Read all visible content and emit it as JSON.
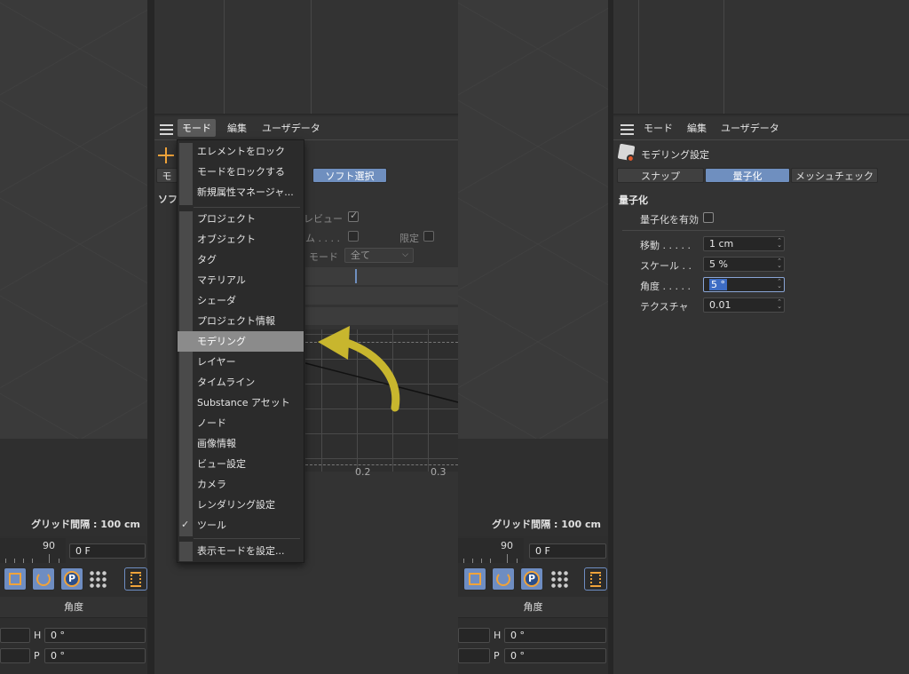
{
  "left_panel": {
    "grid_label": "グリッド間隔 : 100 cm",
    "ruler_label": "90",
    "frame_value": "0 F",
    "section_title": "角度",
    "rows": [
      {
        "axis": "H",
        "value": "0 °"
      },
      {
        "axis": "P",
        "value": "0 °"
      }
    ]
  },
  "right_viewport": {
    "grid_label": "グリッド間隔 : 100 cm",
    "ruler_label": "90",
    "frame_value": "0 F",
    "section_title": "角度",
    "rows": [
      {
        "axis": "H",
        "value": "0 °"
      },
      {
        "axis": "P",
        "value": "0 °"
      }
    ]
  },
  "middle_panel": {
    "menubar": {
      "mode": "モード",
      "edit": "編集",
      "userdata": "ユーザデータ"
    },
    "tab_soft": "ソフト選択",
    "tab_mo": "モ",
    "section_so": "ソフ",
    "preview_label": "レビュー",
    "time_label": "ム . . . .",
    "limit_label": "限定",
    "mode_label": "モード",
    "mode_select": "全て",
    "graph_ticks": [
      "0.2",
      "0.3"
    ],
    "dropdown": {
      "group1": [
        "エレメントをロック",
        "モードをロックする",
        "新規属性マネージャ..."
      ],
      "group2": [
        "プロジェクト",
        "オブジェクト",
        "タグ",
        "マテリアル",
        "シェーダ",
        "プロジェクト情報",
        "モデリング",
        "レイヤー",
        "タイムライン",
        "Substance アセット",
        "ノード",
        "画像情報",
        "ビュー設定",
        "カメラ",
        "レンダリング設定",
        "ツール"
      ],
      "group3": [
        "表示モードを設定..."
      ],
      "highlighted": "モデリング",
      "checked": "ツール"
    }
  },
  "right_panel": {
    "menubar": {
      "mode": "モード",
      "edit": "編集",
      "userdata": "ユーザデータ"
    },
    "header_title": "モデリング設定",
    "tabs": [
      "スナップ",
      "量子化",
      "メッシュチェック"
    ],
    "selected_tab": "量子化",
    "section_title": "量子化",
    "enable_label": "量子化を有効",
    "fields": [
      {
        "label": "移動 . . . . .",
        "value": "1 cm"
      },
      {
        "label": "スケール . .",
        "value": "5 %"
      },
      {
        "label": "角度 . . . . .",
        "value": "5 °"
      },
      {
        "label": "テクスチャ",
        "value": "0.01"
      }
    ]
  },
  "colors": {
    "accent": "#6f8fbf",
    "highlight": "#8b8b8b",
    "arrow": "#c8b62e"
  }
}
